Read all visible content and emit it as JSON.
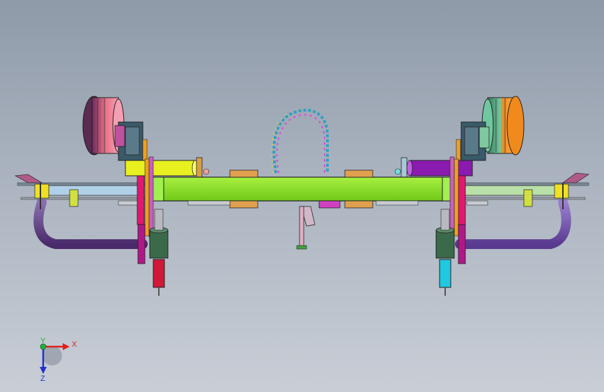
{
  "viewport": {
    "background_top": "#8f9aa9",
    "background_bottom": "#c9ced6"
  },
  "triad": {
    "x_label": "X",
    "y_label": "Y",
    "z_label": "Z",
    "x_color": "#e02020",
    "y_color": "#20b040",
    "z_color": "#2030d0"
  },
  "model": {
    "frame_color": "#88e81a",
    "colors": {
      "left_wheel": "#e87088",
      "right_wheel": "#f08a1c",
      "left_arm": "#e8f020",
      "right_arm": "#8a1ab0",
      "left_rail": "#b0d0e8",
      "right_rail": "#b8e0a8",
      "left_bar": "#6a4a8a",
      "right_bar": "#7a60b0",
      "left_cylinder": "#d01838",
      "right_cylinder": "#20c8e0",
      "hoses": "#30a0c0"
    }
  }
}
